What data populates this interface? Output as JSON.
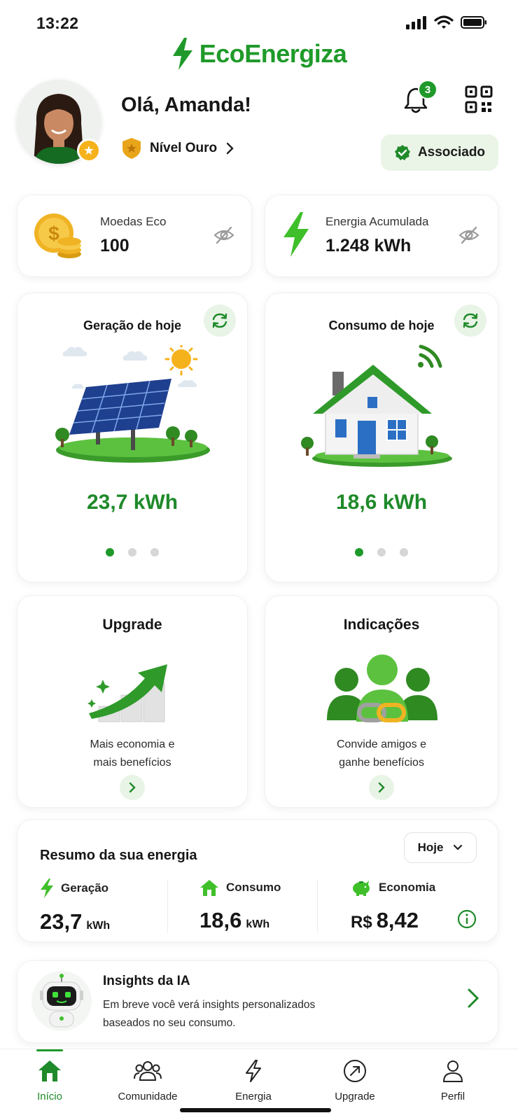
{
  "status_bar": {
    "time": "13:22"
  },
  "app": {
    "name": "EcoEnergiza",
    "accent": "#1f9a2a"
  },
  "header": {
    "greeting": "Olá, Amanda!",
    "level": "Nível Ouro",
    "notifications": "3",
    "membership_badge": "Associado"
  },
  "stats": [
    {
      "label": "Moedas Eco",
      "value": "100",
      "icon": "coins-icon"
    },
    {
      "label": "Energia Acumulada",
      "value": "1.248 kWh",
      "icon": "lightning-icon"
    }
  ],
  "today": [
    {
      "title": "Geração de hoje",
      "value": "23,7 kWh",
      "illustration": "solar-panel"
    },
    {
      "title": "Consumo de hoje",
      "value": "18,6 kWh",
      "illustration": "house"
    }
  ],
  "features": [
    {
      "title": "Upgrade",
      "desc_line1": "Mais economia e",
      "desc_line2": "mais benefícios"
    },
    {
      "title": "Indicações",
      "desc_line1": "Convide amigos e",
      "desc_line2": "ganhe benefícios"
    }
  ],
  "summary": {
    "title": "Resumo da sua energia",
    "period": "Hoje",
    "generation": {
      "label": "Geração",
      "value": "23,7",
      "unit": "kWh"
    },
    "consumption": {
      "label": "Consumo",
      "value": "18,6",
      "unit": "kWh"
    },
    "savings": {
      "label": "Economia",
      "currency": "R$",
      "value": "8,42"
    }
  },
  "insights": {
    "title": "Insights da IA",
    "line1": "Em breve você verá insights personalizados",
    "line2": "baseados no seu consumo."
  },
  "nav": [
    {
      "label": "Início",
      "icon": "home-icon",
      "active": true
    },
    {
      "label": "Comunidade",
      "icon": "community-icon"
    },
    {
      "label": "Energia",
      "icon": "lightning-icon"
    },
    {
      "label": "Upgrade",
      "icon": "upgrade-icon"
    },
    {
      "label": "Perfil",
      "icon": "profile-icon"
    }
  ]
}
